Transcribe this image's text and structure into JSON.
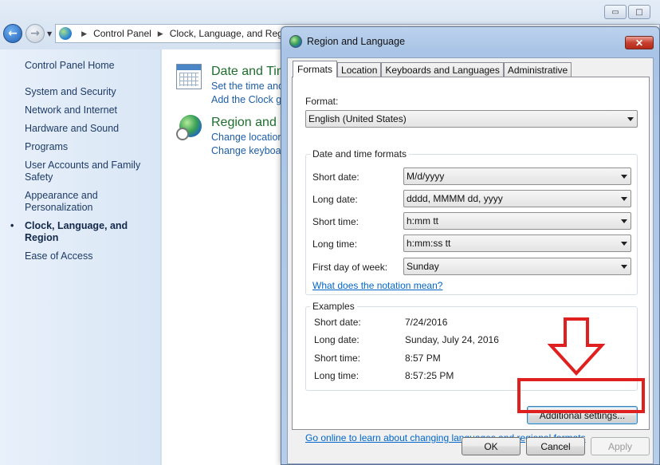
{
  "window_controls": {
    "minimize": "▭",
    "maximize": "□",
    "close": "✕"
  },
  "nav": {
    "back_icon": "←",
    "forward_icon": "→",
    "breadcrumb": [
      "Control Panel",
      "Clock, Language, and Region"
    ],
    "separator": "▶"
  },
  "sidebar": {
    "home": "Control Panel Home",
    "items": [
      {
        "label": "System and Security"
      },
      {
        "label": "Network and Internet"
      },
      {
        "label": "Hardware and Sound"
      },
      {
        "label": "Programs"
      },
      {
        "label": "User Accounts and Family Safety"
      },
      {
        "label": "Appearance and Personalization"
      },
      {
        "label": "Clock, Language, and Region",
        "active": true
      },
      {
        "label": "Ease of Access"
      }
    ]
  },
  "main": {
    "categories": [
      {
        "title": "Date and Tim",
        "links": [
          "Set the time and",
          "Add the Clock ga"
        ]
      },
      {
        "title": "Region and L",
        "links": [
          "Change location",
          "Change keyboard"
        ]
      }
    ]
  },
  "dialog": {
    "title": "Region and Language",
    "close_icon": "✕",
    "tabs": [
      "Formats",
      "Location",
      "Keyboards and Languages",
      "Administrative"
    ],
    "selected_tab": "Formats",
    "format_label": "Format:",
    "format_value": "English (United States)",
    "date_time_group": "Date and time formats",
    "fields": [
      {
        "label": "Short date:",
        "value": "M/d/yyyy"
      },
      {
        "label": "Long date:",
        "value": "dddd, MMMM dd, yyyy"
      },
      {
        "label": "Short time:",
        "value": "h:mm tt"
      },
      {
        "label": "Long time:",
        "value": "h:mm:ss tt"
      },
      {
        "label": "First day of week:",
        "value": "Sunday"
      }
    ],
    "notation_link": "What does the notation mean?",
    "examples_group": "Examples",
    "examples": [
      {
        "label": "Short date:",
        "value": "7/24/2016"
      },
      {
        "label": "Long date:",
        "value": "Sunday, July 24, 2016"
      },
      {
        "label": "Short time:",
        "value": "8:57 PM"
      },
      {
        "label": "Long time:",
        "value": "8:57:25 PM"
      }
    ],
    "additional_settings": "Additional settings...",
    "online_link": "Go online to learn about changing languages and regional formats",
    "ok": "OK",
    "cancel": "Cancel",
    "apply": "Apply"
  },
  "annotation": {
    "color": "#e01f1f"
  }
}
